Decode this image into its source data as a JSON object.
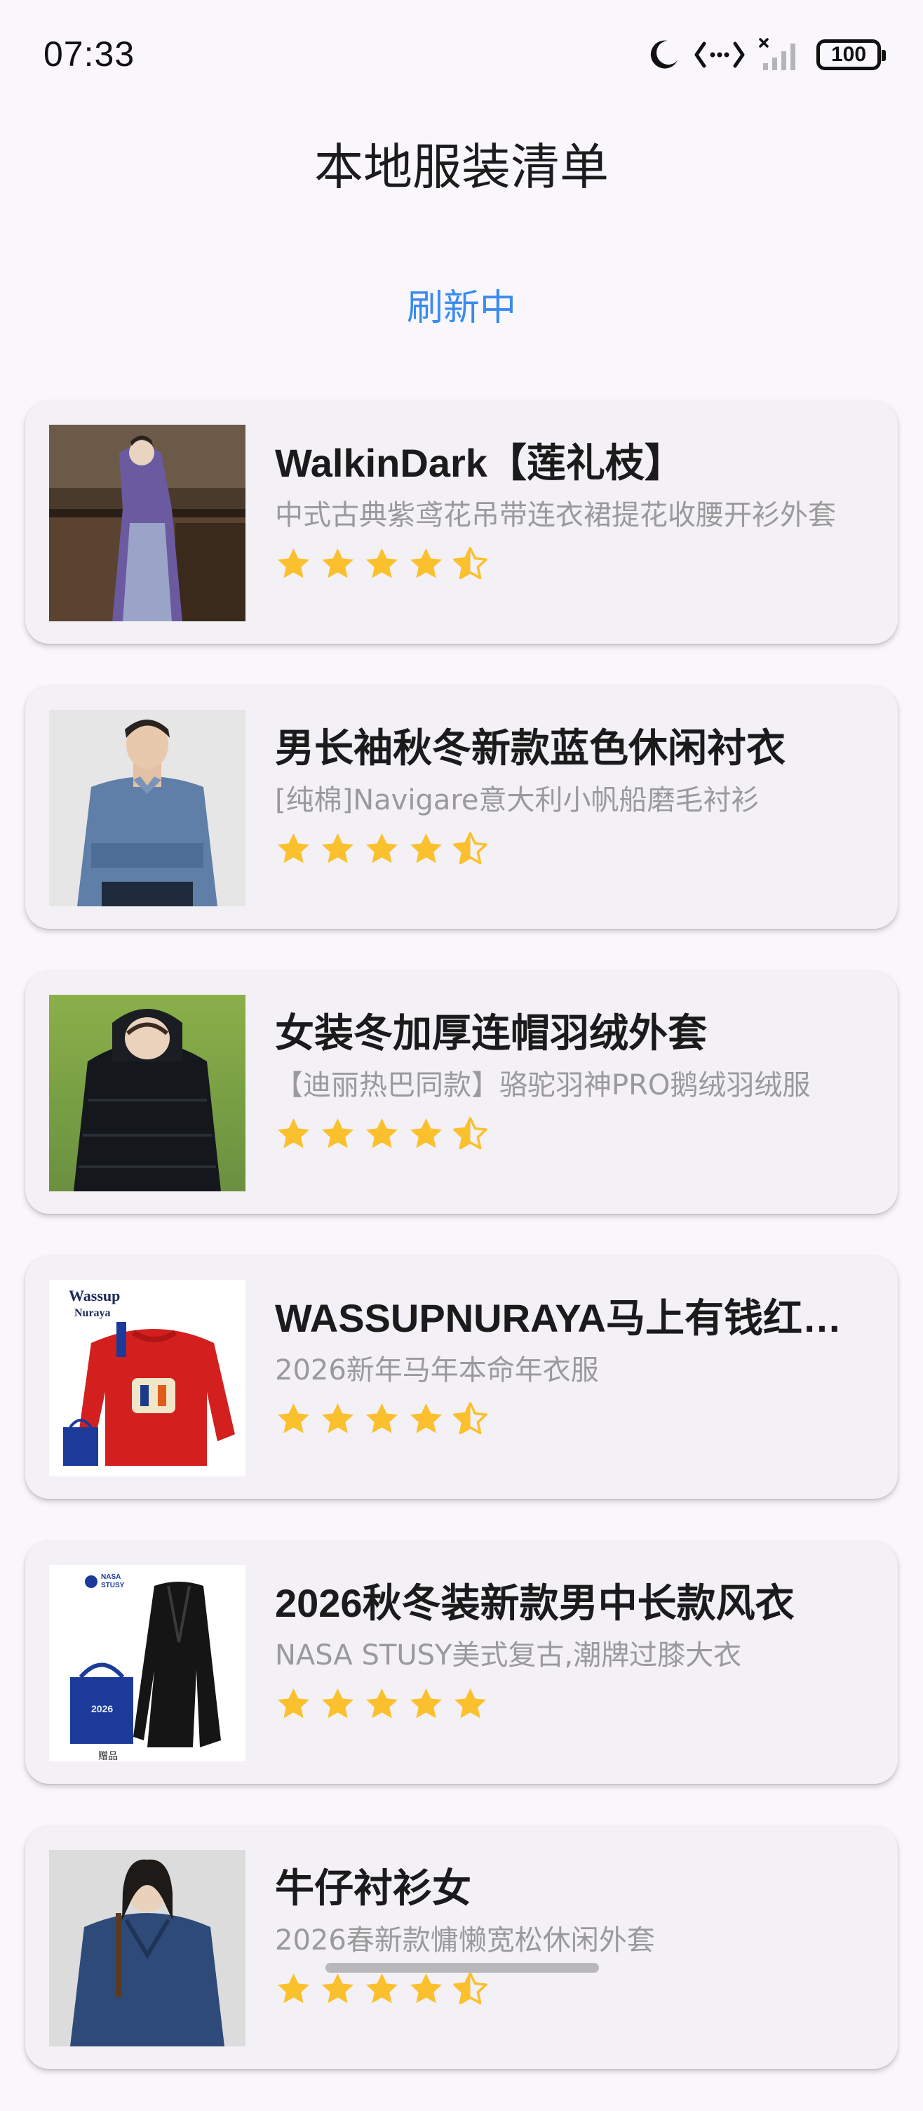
{
  "status_bar": {
    "time": "07:33",
    "battery": "100",
    "icons": [
      "moon-icon",
      "data-transfer-icon",
      "signal-no-service-icon",
      "battery-icon"
    ]
  },
  "header": {
    "title": "本地服装清单"
  },
  "refresh": {
    "label": "刷新中"
  },
  "colors": {
    "accent": "#3a8bf0",
    "star": "#fbc02d",
    "card_bg": "#f3f1f5",
    "page_bg": "#f9f7fb"
  },
  "items": [
    {
      "title": "WalkinDark【莲礼枝】",
      "subtitle": "中式古典紫鸢花吊带连衣裙提花收腰开衫外套",
      "rating": 4.5,
      "image": "purple-dress-photo"
    },
    {
      "title": "男长袖秋冬新款蓝色休闲衬衣",
      "subtitle": "[纯棉]Navigare意大利小帆船磨毛衬衫",
      "rating": 4.5,
      "image": "blue-shirt-photo"
    },
    {
      "title": "女装冬加厚连帽羽绒外套",
      "subtitle": "【迪丽热巴同款】骆驼羽神PRO鹅绒羽绒服",
      "rating": 4.5,
      "image": "black-down-jacket-photo"
    },
    {
      "title": "WASSUPNURAYA马上有钱红色卫衣",
      "subtitle": "2026新年马年本命年衣服",
      "rating": 4.5,
      "image": "red-sweater-photo",
      "image_logo_text": [
        "Wassup",
        "Nuraya"
      ]
    },
    {
      "title": "2026秋冬装新款男中长款风衣",
      "subtitle": "NASA STUSY美式复古,潮牌过膝大衣",
      "rating": 5,
      "image": "black-trench-coat-photo",
      "image_logo_text": [
        "NASA",
        "STUSY",
        "赠品"
      ]
    },
    {
      "title": "牛仔衬衫女",
      "subtitle": "2026春新款慵懒宽松休闲外套",
      "rating": 4.5,
      "image": "denim-shirt-photo"
    }
  ]
}
